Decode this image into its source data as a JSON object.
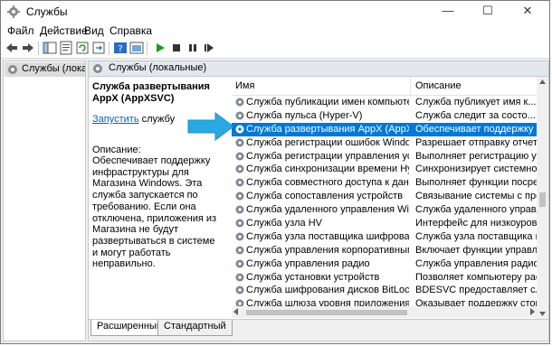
{
  "window": {
    "title": "Службы"
  },
  "menu": [
    "Файл",
    "Действие",
    "Вид",
    "Справка"
  ],
  "tree": {
    "item": "Службы (локалы"
  },
  "panel": {
    "header": "Службы (локальные)"
  },
  "details": {
    "title": "Служба развертывания AppX (AppXSVC)",
    "start_link": "Запустить",
    "start_suffix": " службу",
    "desc_caption": "Описание:",
    "desc_text": "Обеспечивает поддержку инфраструктуры для Магазина Windows. Эта служба запускается по требованию. Если она отключена, приложения из Магазина не будут развертываться в системе и могут работать неправильно."
  },
  "list": {
    "col_name": "Имя",
    "col_desc": "Описание",
    "rows": [
      {
        "name": "Служба публикации имен компьютеров ...",
        "desc": "Служба публикует имя к..."
      },
      {
        "name": "Служба пульса (Hyper-V)",
        "desc": "Служба следит за состо..."
      },
      {
        "name": "Служба развертывания AppX (AppXSVC)",
        "desc": "Обеспечивает поддержку ин..."
      },
      {
        "name": "Служба регистрации ошибок Windows",
        "desc": "Разрешает отправку отчето..."
      },
      {
        "name": "Служба регистрации управления устрой...",
        "desc": "Выполняет регистрацию ус..."
      },
      {
        "name": "Служба синхронизации времени Hyper-V",
        "desc": "Синхронизирует системно..."
      },
      {
        "name": "Служба совместного доступа к данным",
        "desc": "Выполняет функции посред..."
      },
      {
        "name": "Служба сопоставления устройств",
        "desc": "Связывание системы с пров..."
      },
      {
        "name": "Служба удаленного управления Windows...",
        "desc": "Служба удаленного управл..."
      },
      {
        "name": "Служба узла HV",
        "desc": "Интерфейс для низкоуровн..."
      },
      {
        "name": "Служба узла поставщика шифрования W...",
        "desc": "Служба узла поставщика ш..."
      },
      {
        "name": "Служба управления корпоративными пр...",
        "desc": "Включает функции управле..."
      },
      {
        "name": "Служба управления радио",
        "desc": "Служба управления радио ..."
      },
      {
        "name": "Служба установки устройств",
        "desc": "Позволяет компьютеру рас..."
      },
      {
        "name": "Служба шифрования дисков BitLocker",
        "desc": "BDESVC предоставляет служ..."
      },
      {
        "name": "Служба шлюза уровня приложения",
        "desc": "Оказывает поддержку стор..."
      }
    ],
    "selected_index": 2
  },
  "tabs": {
    "extended": "Расширенный",
    "standard": "Стандартный"
  },
  "colors": {
    "selection": "#0078d7",
    "arrow": "#29a9e1",
    "link": "#0563c1"
  },
  "icons": [
    "app-icon",
    "back-icon",
    "forward-icon",
    "show-tree-icon",
    "properties-icon",
    "refresh-icon",
    "export-icon",
    "help-icon",
    "mmc-icon",
    "play-icon",
    "stop-icon",
    "pause-icon",
    "restart-icon",
    "gear-icon",
    "arrow-icon"
  ]
}
